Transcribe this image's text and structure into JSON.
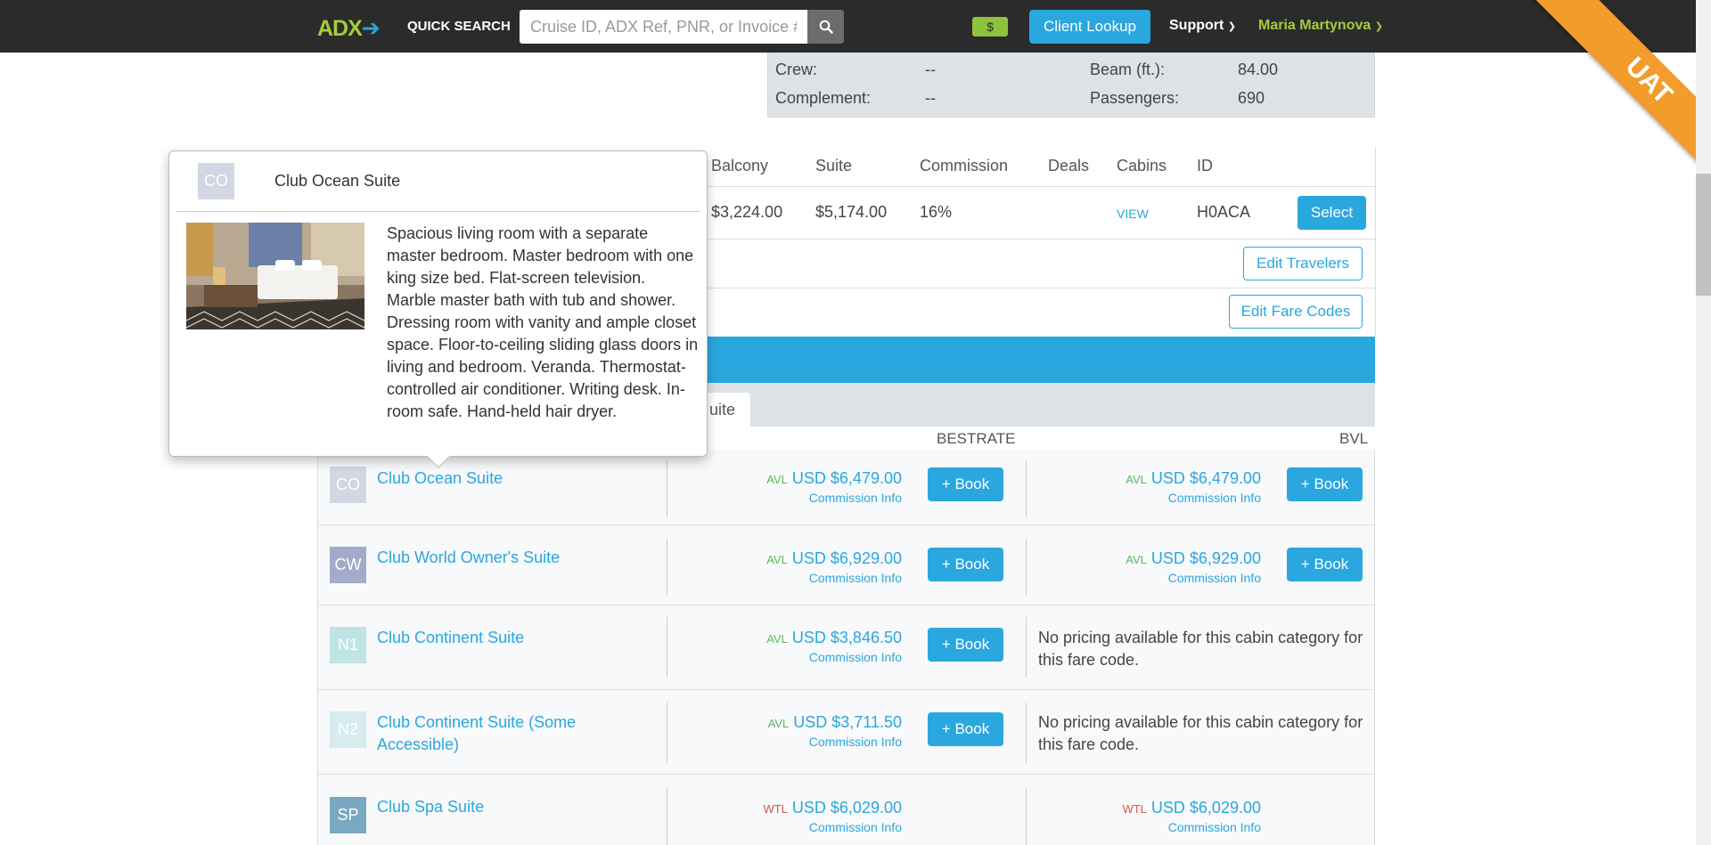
{
  "header": {
    "logo_main": "ADX",
    "quick_search_label": "QUICK SEARCH",
    "search_placeholder": "Cruise ID, ADX Ref, PNR, or Invoice #.",
    "money_label": "$",
    "client_lookup_label": "Client Lookup",
    "support_label": "Support",
    "user_name": "Maria Martynova",
    "env_ribbon": "UAT"
  },
  "ship_info": {
    "crew_label": "Crew:",
    "crew_value": "--",
    "complement_label": "Complement:",
    "complement_value": "--",
    "beam_label": "Beam (ft.):",
    "beam_value": "84.00",
    "passengers_label": "Passengers:",
    "passengers_value": "690"
  },
  "fare_table": {
    "headers": [
      "Balcony",
      "Suite",
      "Commission",
      "Deals",
      "Cabins",
      "ID"
    ],
    "row": {
      "balcony": "$3,224.00",
      "suite": "$5,174.00",
      "commission": "16%",
      "cabins_link": "VIEW",
      "id": "H0ACA",
      "select_label": "Select"
    },
    "edit_travelers_label": "Edit Travelers",
    "edit_fare_codes_label": "Edit Fare Codes"
  },
  "tabs": {
    "active_tab_label": "uite"
  },
  "cabin_columns": {
    "col1": "BESTRATE",
    "col2": "BVL"
  },
  "cabins": [
    {
      "code": "CO",
      "name": "Club Ocean Suite",
      "badge_color": "#d2d7e3",
      "c1_status": "AVL",
      "c1_price": "USD $6,479.00",
      "c1_comm": "Commission Info",
      "c1_book": "+ Book",
      "c2_status": "AVL",
      "c2_price": "USD $6,479.00",
      "c2_comm": "Commission Info",
      "c2_book": "+ Book"
    },
    {
      "code": "CW",
      "name": "Club World Owner's Suite",
      "badge_color": "#a3abcb",
      "c1_status": "AVL",
      "c1_price": "USD $6,929.00",
      "c1_comm": "Commission Info",
      "c1_book": "+ Book",
      "c2_status": "AVL",
      "c2_price": "USD $6,929.00",
      "c2_comm": "Commission Info",
      "c2_book": "+ Book"
    },
    {
      "code": "N1",
      "name": "Club Continent Suite",
      "badge_color": "#bfe4e3",
      "c1_status": "AVL",
      "c1_price": "USD $3,846.50",
      "c1_comm": "Commission Info",
      "c1_book": "+ Book",
      "c2_nopricing": "No pricing available for this cabin category for this fare code."
    },
    {
      "code": "N2",
      "name": "Club Continent Suite (Some Accessible)",
      "badge_color": "#d6ecef",
      "c1_status": "AVL",
      "c1_price": "USD $3,711.50",
      "c1_comm": "Commission Info",
      "c1_book": "+ Book",
      "c2_nopricing": "No pricing available for this cabin category for this fare code."
    },
    {
      "code": "SP",
      "name": "Club Spa Suite",
      "badge_color": "#7aa8c0",
      "c1_status": "WTL",
      "c1_price": "USD $6,029.00",
      "c1_comm": "Commission Info",
      "c2_status": "WTL",
      "c2_price": "USD $6,029.00",
      "c2_comm": "Commission Info"
    }
  ],
  "popover": {
    "code": "CO",
    "title": "Club Ocean Suite",
    "description": "Spacious living room with a separate master bedroom. Master bedroom with one king size bed. Flat-screen television. Marble master bath with tub and shower. Dressing room with vanity and ample closet space. Floor-to-ceiling sliding glass doors in living and bedroom. Veranda. Thermostat-controlled air conditioner. Writing desk. In-room safe. Hand-held hair dryer."
  },
  "colors": {
    "accent": "#2aa7df",
    "avl": "#5cb85c",
    "wtl": "#d9534f",
    "topbar": "#2b2b2b",
    "brand_green": "#a4cc39",
    "ribbon": "#f39c2b"
  }
}
